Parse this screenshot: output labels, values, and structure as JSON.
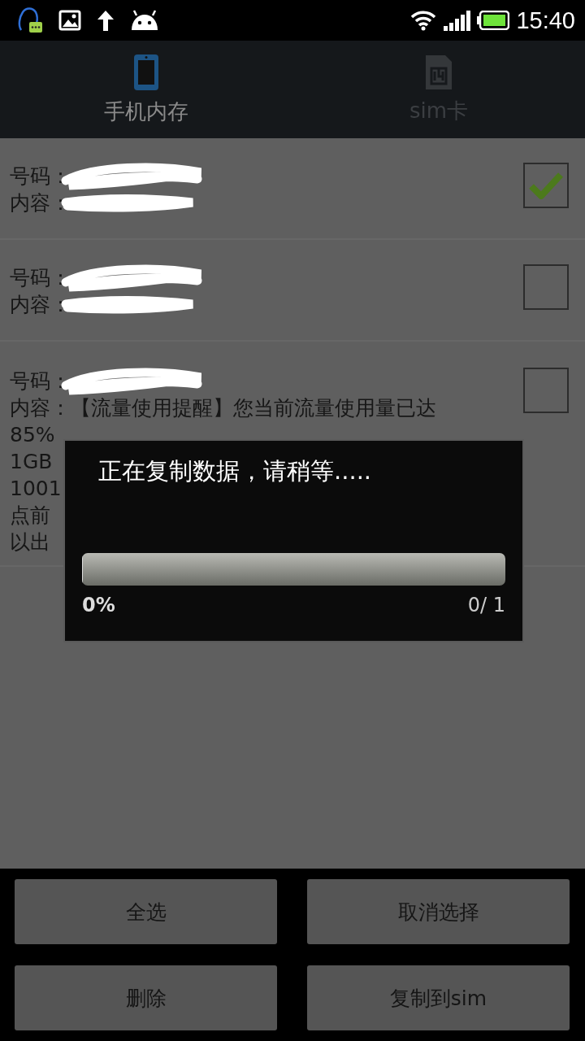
{
  "status_bar": {
    "time": "15:40"
  },
  "tabs": [
    {
      "label": "手机内存",
      "kind": "phone",
      "selected": true
    },
    {
      "label": "sim卡",
      "kind": "sim",
      "selected": false
    }
  ],
  "messages": [
    {
      "number_label": "号码：",
      "content_label": "内容：",
      "number_redacted": true,
      "content_redacted": true,
      "checked": true
    },
    {
      "number_label": "号码：",
      "content_label": "内容：",
      "number_redacted": true,
      "content_redacted": true,
      "checked": false
    },
    {
      "number_label": "号码：",
      "content_label": "内容：【流量使用提醒】您当前流量使用量已达",
      "number_redacted": true,
      "content_redacted": false,
      "continuation": [
        "85%",
        "1GB",
        "1001",
        "点前",
        "以出"
      ],
      "checked": false
    }
  ],
  "dialog": {
    "title": "正在复制数据，请稍等.....",
    "progress": {
      "level": 0
    },
    "percent": "0%",
    "count": "0/ 1"
  },
  "buttons": [
    {
      "label": "全选"
    },
    {
      "label": "取消选择"
    },
    {
      "label": "删除"
    },
    {
      "label": "复制到sim"
    }
  ]
}
